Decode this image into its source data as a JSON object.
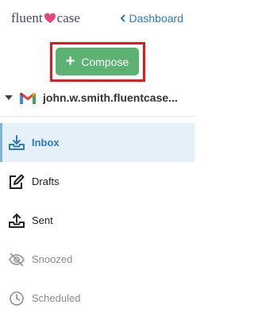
{
  "header": {
    "logo_left": "fluent",
    "logo_right": "case",
    "dashboard_label": "Dashboard"
  },
  "compose": {
    "label": "Compose",
    "icon": "plus-icon"
  },
  "account": {
    "email": "john.w.smith.fluentcase..."
  },
  "nav": {
    "items": [
      {
        "label": "Inbox",
        "icon": "inbox-icon",
        "active": true
      },
      {
        "label": "Drafts",
        "icon": "edit-icon"
      },
      {
        "label": "Sent",
        "icon": "send-icon"
      },
      {
        "label": "Snoozed",
        "icon": "eye-slash-icon"
      },
      {
        "label": "Scheduled",
        "icon": "clock-icon"
      }
    ]
  },
  "colors": {
    "accent_blue": "#2a7bc0",
    "compose_green": "#5cb270",
    "highlight_red": "#e01b1b",
    "active_bg": "#e6f0f9",
    "logo_heart": "#e0487a"
  }
}
